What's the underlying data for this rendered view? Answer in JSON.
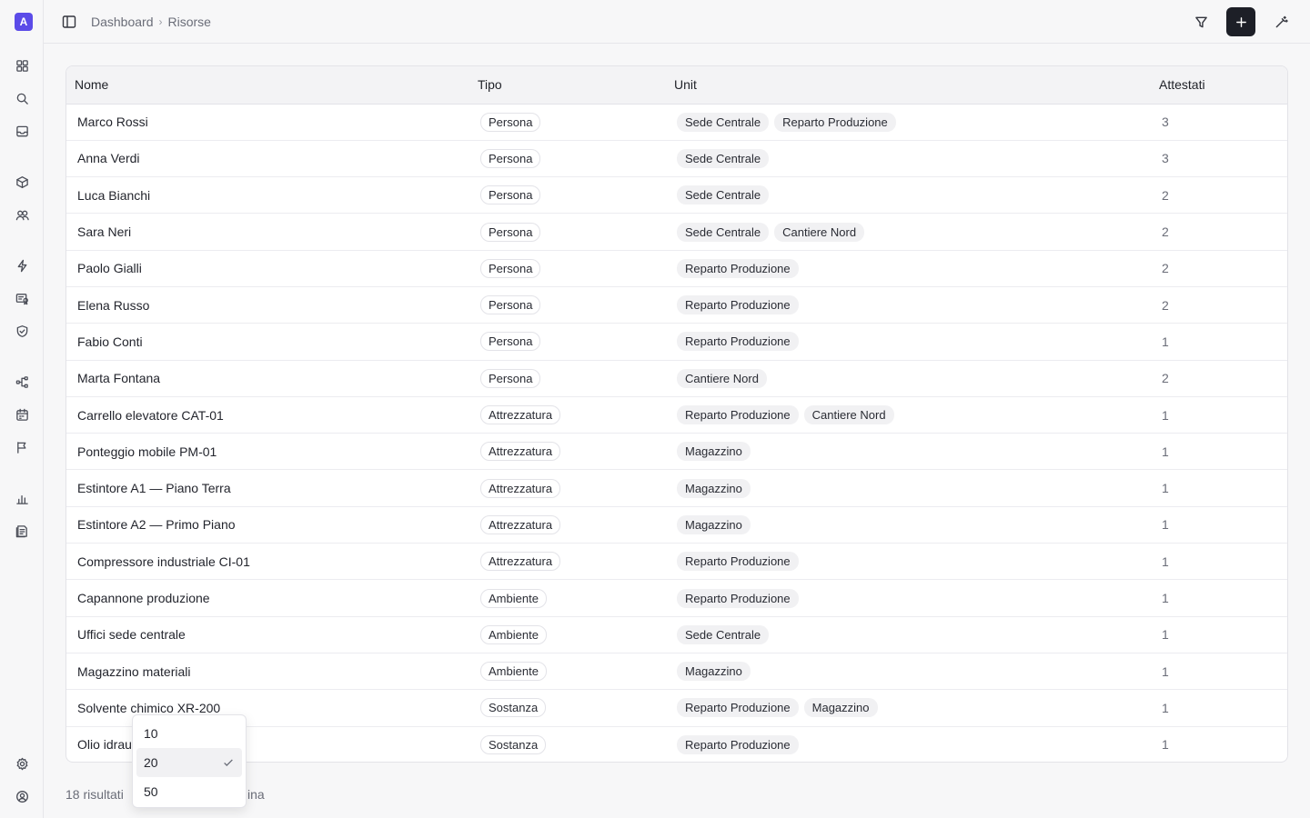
{
  "app": {
    "logo_letter": "A",
    "accent": "#5b4be8"
  },
  "sidebar": {
    "icons": [
      "grid-icon",
      "search-icon",
      "inbox-icon",
      "box-icon",
      "users-icon",
      "bolt-icon",
      "certificate-icon",
      "shield-icon",
      "flow-icon",
      "calendar-icon",
      "flag-icon",
      "chart-icon",
      "report-icon",
      "settings-icon",
      "account-icon"
    ]
  },
  "header": {
    "breadcrumb": [
      "Dashboard",
      "Risorse"
    ]
  },
  "table": {
    "headers": {
      "name": "Nome",
      "type": "Tipo",
      "unit": "Unit",
      "certs": "Attestati"
    },
    "rows": [
      {
        "name": "Marco Rossi",
        "type": "Persona",
        "units": [
          "Sede Centrale",
          "Reparto Produzione"
        ],
        "certs": "3"
      },
      {
        "name": "Anna Verdi",
        "type": "Persona",
        "units": [
          "Sede Centrale"
        ],
        "certs": "3"
      },
      {
        "name": "Luca Bianchi",
        "type": "Persona",
        "units": [
          "Sede Centrale"
        ],
        "certs": "2"
      },
      {
        "name": "Sara Neri",
        "type": "Persona",
        "units": [
          "Sede Centrale",
          "Cantiere Nord"
        ],
        "certs": "2"
      },
      {
        "name": "Paolo Gialli",
        "type": "Persona",
        "units": [
          "Reparto Produzione"
        ],
        "certs": "2"
      },
      {
        "name": "Elena Russo",
        "type": "Persona",
        "units": [
          "Reparto Produzione"
        ],
        "certs": "2"
      },
      {
        "name": "Fabio Conti",
        "type": "Persona",
        "units": [
          "Reparto Produzione"
        ],
        "certs": "1"
      },
      {
        "name": "Marta Fontana",
        "type": "Persona",
        "units": [
          "Cantiere Nord"
        ],
        "certs": "2"
      },
      {
        "name": "Carrello elevatore CAT-01",
        "type": "Attrezzatura",
        "units": [
          "Reparto Produzione",
          "Cantiere Nord"
        ],
        "certs": "1"
      },
      {
        "name": "Ponteggio mobile PM-01",
        "type": "Attrezzatura",
        "units": [
          "Magazzino"
        ],
        "certs": "1"
      },
      {
        "name": "Estintore A1 — Piano Terra",
        "type": "Attrezzatura",
        "units": [
          "Magazzino"
        ],
        "certs": "1"
      },
      {
        "name": "Estintore A2 — Primo Piano",
        "type": "Attrezzatura",
        "units": [
          "Magazzino"
        ],
        "certs": "1"
      },
      {
        "name": "Compressore industriale CI-01",
        "type": "Attrezzatura",
        "units": [
          "Reparto Produzione"
        ],
        "certs": "1"
      },
      {
        "name": "Capannone produzione",
        "type": "Ambiente",
        "units": [
          "Reparto Produzione"
        ],
        "certs": "1"
      },
      {
        "name": "Uffici sede centrale",
        "type": "Ambiente",
        "units": [
          "Sede Centrale"
        ],
        "certs": "1"
      },
      {
        "name": "Magazzino materiali",
        "type": "Ambiente",
        "units": [
          "Magazzino"
        ],
        "certs": "1"
      },
      {
        "name": "Solvente chimico XR-200",
        "type": "Sostanza",
        "units": [
          "Reparto Produzione",
          "Magazzino"
        ],
        "certs": "1"
      },
      {
        "name": "Olio idrau",
        "type": "Sostanza",
        "units": [
          "Reparto Produzione"
        ],
        "certs": "1"
      }
    ]
  },
  "footer": {
    "results": "18 risultati",
    "tail": "ina"
  },
  "page_size_dropdown": {
    "options": [
      "10",
      "20",
      "50"
    ],
    "selected": "20"
  }
}
